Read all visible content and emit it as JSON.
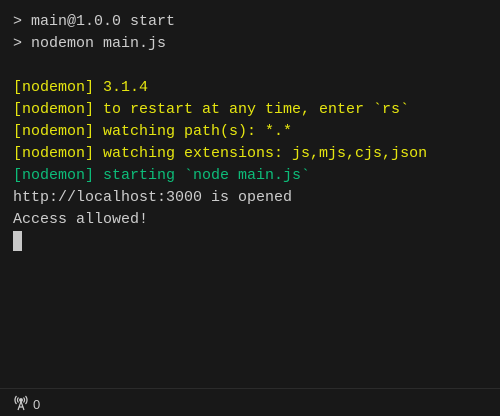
{
  "terminal": {
    "lines": [
      {
        "text": "> main@1.0.0 start",
        "style": "default"
      },
      {
        "text": "> nodemon main.js",
        "style": "default"
      },
      {
        "text": "",
        "style": "default"
      },
      {
        "text": "[nodemon] 3.1.4",
        "style": "yellow"
      },
      {
        "text": "[nodemon] to restart at any time, enter `rs`",
        "style": "yellow"
      },
      {
        "text": "[nodemon] watching path(s): *.*",
        "style": "yellow"
      },
      {
        "text": "[nodemon] watching extensions: js,mjs,cjs,json",
        "style": "yellow"
      },
      {
        "text": "[nodemon] starting `node main.js`",
        "style": "green"
      },
      {
        "text": "http://localhost:3000 is opened",
        "style": "default"
      },
      {
        "text": "Access allowed!",
        "style": "default"
      }
    ]
  },
  "status_bar": {
    "ports_icon": "broadcast-icon",
    "ports_count": "0"
  },
  "colors": {
    "yellow": "#e5e510",
    "green": "#0dbc79",
    "text": "#cccccc",
    "background": "#181818"
  }
}
